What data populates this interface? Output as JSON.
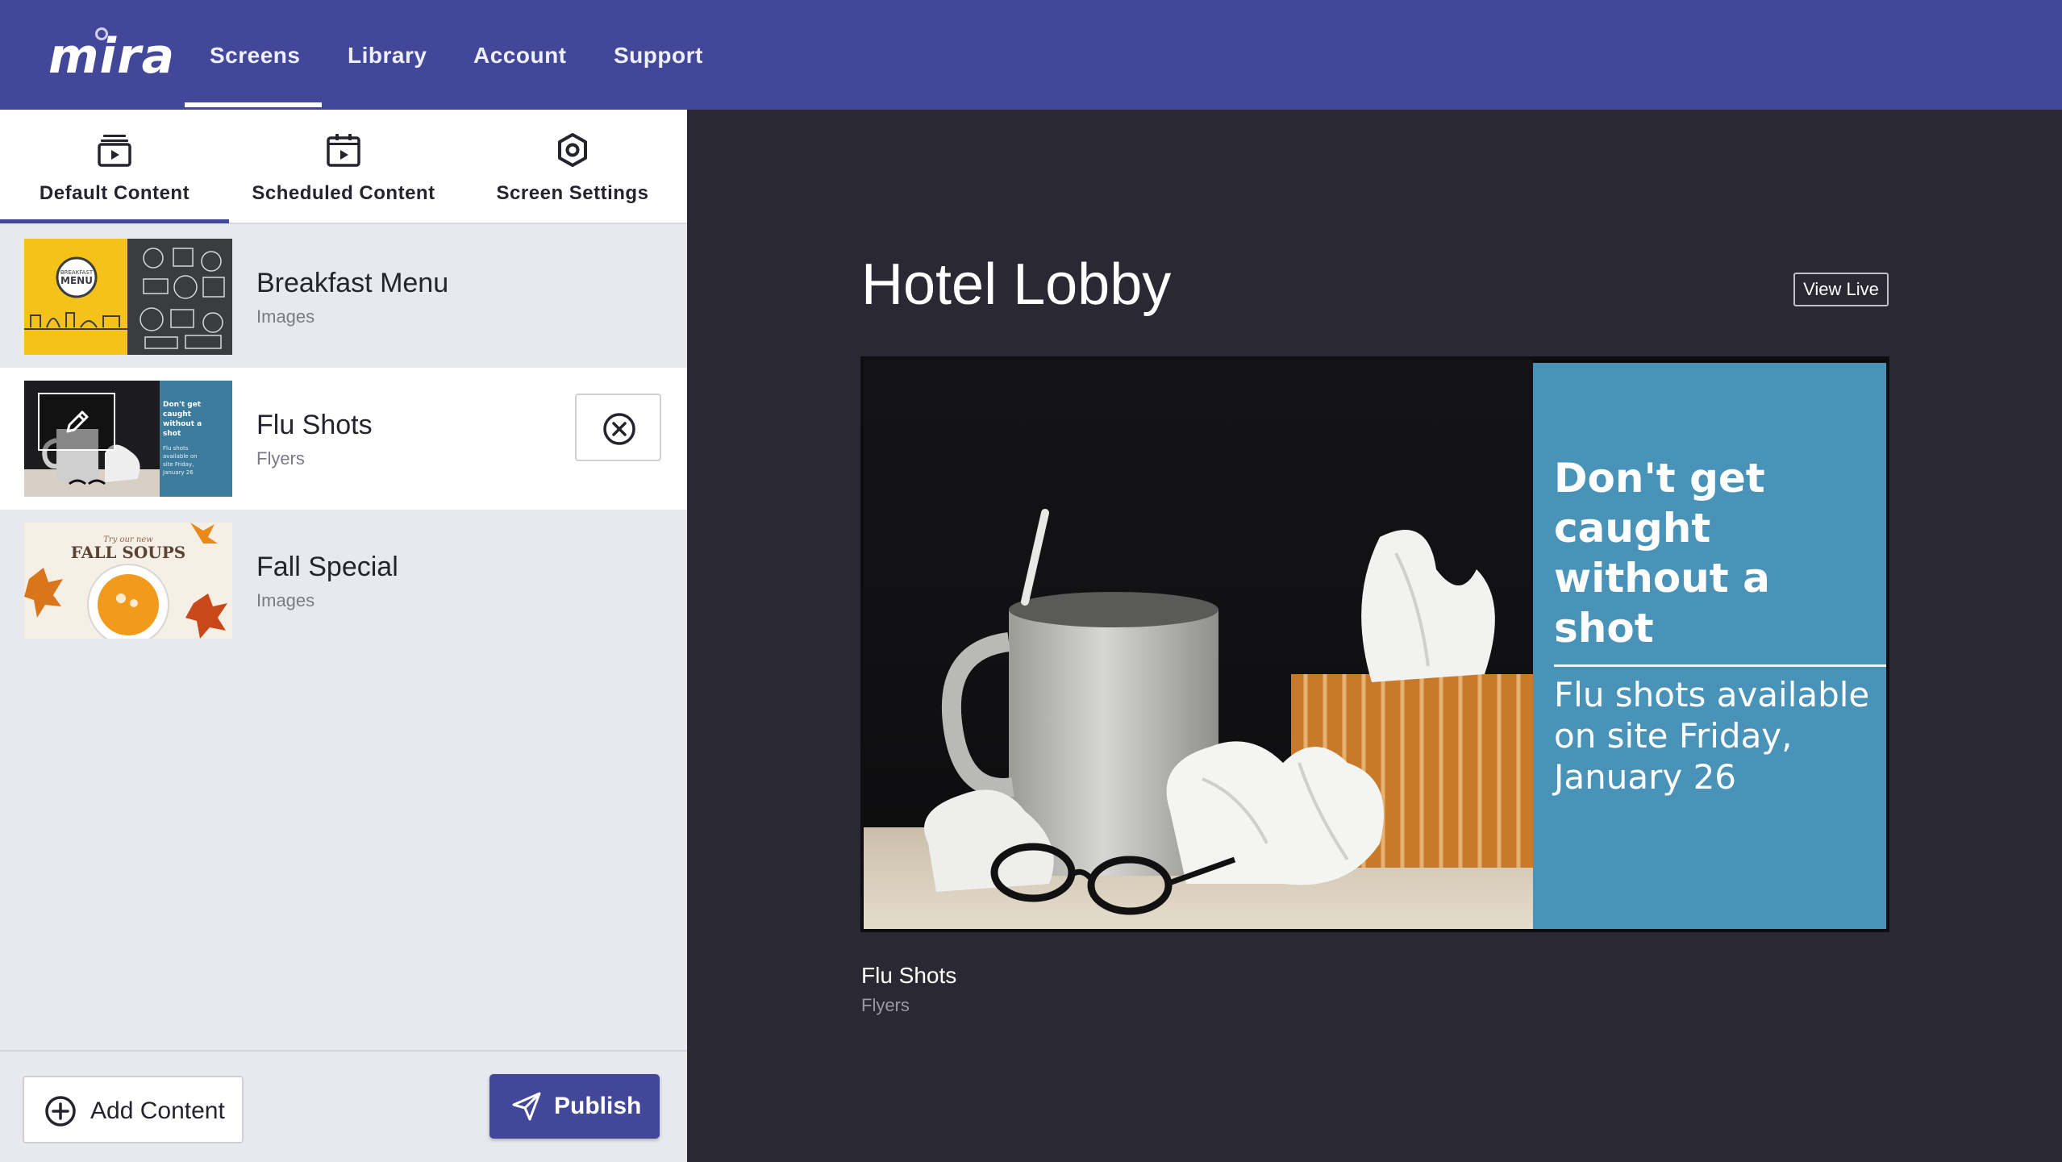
{
  "app": {
    "logo": "mira",
    "nav": [
      {
        "label": "Screens",
        "active": true
      },
      {
        "label": "Library",
        "active": false
      },
      {
        "label": "Account",
        "active": false
      },
      {
        "label": "Support",
        "active": false
      }
    ],
    "accent_color": "#42479a"
  },
  "sidebar": {
    "tabs": [
      {
        "label": "Default Content",
        "icon": "stacked-play-icon",
        "active": true
      },
      {
        "label": "Scheduled Content",
        "icon": "calendar-play-icon",
        "active": false
      },
      {
        "label": "Screen Settings",
        "icon": "gear-icon",
        "active": false
      }
    ],
    "items": [
      {
        "title": "Breakfast Menu",
        "type": "Images",
        "selected": false,
        "thumb_text": {
          "badge_line1": "BREAKFAST",
          "badge_line2": "MENU"
        }
      },
      {
        "title": "Flu Shots",
        "type": "Flyers",
        "selected": true,
        "thumb_text": {
          "headline": "Don't get caught without a shot",
          "body": "Flu shots available on site Friday, January 26"
        }
      },
      {
        "title": "Fall Special",
        "type": "Images",
        "selected": false,
        "thumb_text": {
          "kicker": "Try our new",
          "headline": "FALL SOUPS"
        }
      }
    ],
    "add_content_label": "Add Content",
    "publish_label": "Publish"
  },
  "preview": {
    "screen_name": "Hotel Lobby",
    "view_live_label": "View Live",
    "flyer_headline": "Don't get caught without a shot",
    "flyer_body": "Flu shots available on site Friday, January 26",
    "caption_title": "Flu Shots",
    "caption_type": "Flyers",
    "flyer_color": "#4a93b8"
  }
}
